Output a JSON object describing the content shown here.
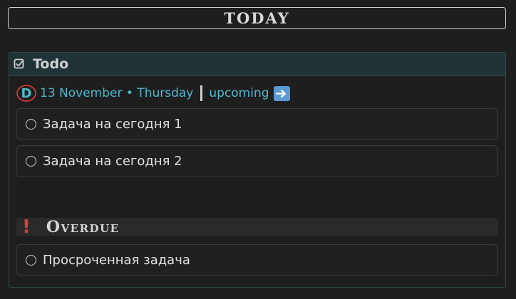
{
  "header": {
    "title": "TODAY"
  },
  "todo_section": {
    "title": "Todo",
    "badge_letter": "D",
    "date_text": "13 November • Thursday",
    "separator": "|",
    "upcoming_link": "upcoming",
    "tasks": [
      {
        "label": "Задача на сегодня 1",
        "checked": false
      },
      {
        "label": "Задача на сегодня 2",
        "checked": false
      }
    ]
  },
  "overdue_section": {
    "title": "Overdue",
    "tasks": [
      {
        "label": "Просроченная задача",
        "checked": false
      }
    ]
  },
  "colors": {
    "accent": "#4fb7cc",
    "panel_header": "#1f3336",
    "danger": "#e03a3a"
  },
  "icons": [
    "checkbox-icon",
    "daily-note-badge-icon",
    "arrow-right-icon",
    "exclamation-icon",
    "radio-circle-icon"
  ]
}
